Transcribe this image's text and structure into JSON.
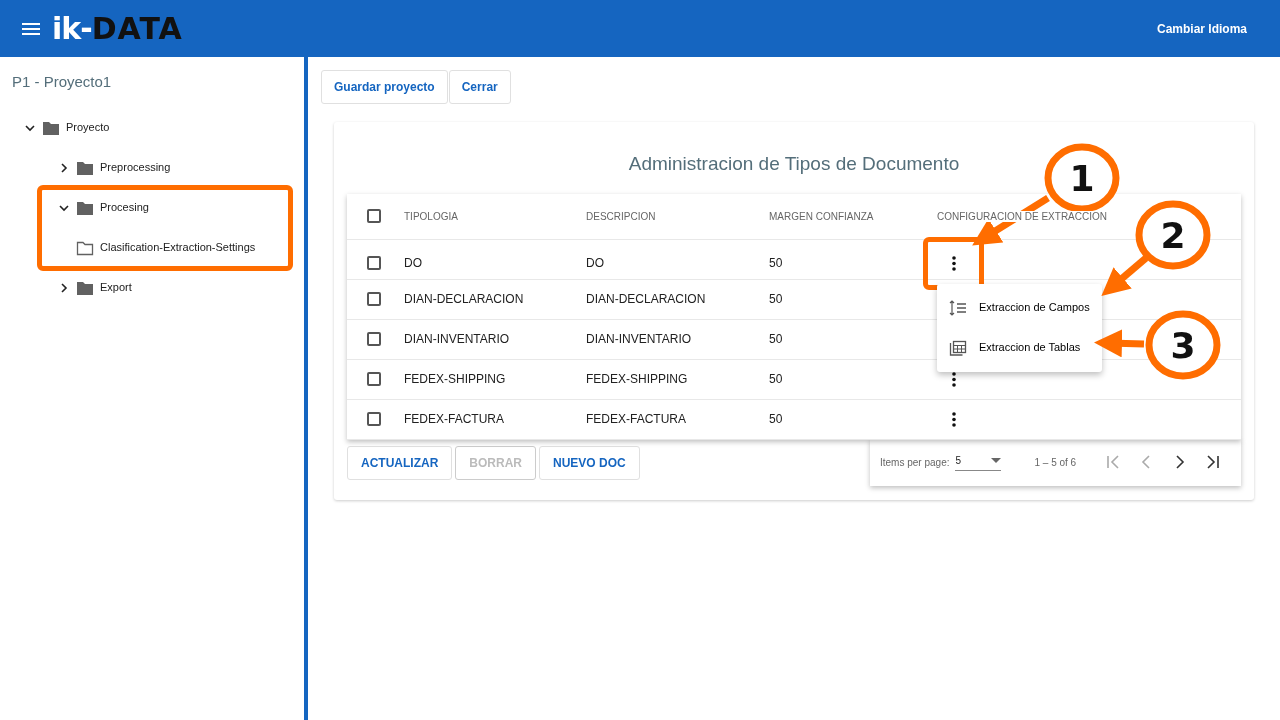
{
  "header": {
    "logo_light": "ik-",
    "logo_dark": "DATA",
    "language_button": "Cambiar Idioma"
  },
  "sidebar": {
    "title": "P1 - Proyecto1",
    "tree": [
      {
        "label": "Proyecto",
        "kind": "folder",
        "expanded": true,
        "highlighted": false,
        "children": [
          {
            "label": "Preprocessing",
            "kind": "folder",
            "expanded": false,
            "highlighted": false
          },
          {
            "label": "Procesing",
            "kind": "folder",
            "expanded": true,
            "highlighted": true,
            "children": [
              {
                "label": "Clasification-Extraction-Settings",
                "kind": "leaf",
                "highlighted": false
              }
            ]
          },
          {
            "label": "Export",
            "kind": "folder",
            "expanded": false,
            "highlighted": false
          }
        ]
      }
    ]
  },
  "toolbar": [
    "Guardar proyecto",
    "Cerrar"
  ],
  "panel": {
    "title": "Administracion de Tipos de Documento",
    "table": {
      "select_all_checked": false,
      "columns": [
        "TIPOLOGIA",
        "DESCRIPCION",
        "MARGEN CONFIANZA",
        "CONFIGURACION DE EXTRACCION"
      ],
      "rows": [
        {
          "checked": false,
          "cells": [
            "DO",
            "DO",
            "50"
          ],
          "actions": true,
          "highlighted": true
        },
        {
          "checked": false,
          "cells": [
            "DIAN-DECLARACION",
            "DIAN-DECLARACION",
            "50"
          ],
          "actions": false
        },
        {
          "checked": false,
          "cells": [
            "DIAN-INVENTARIO",
            "DIAN-INVENTARIO",
            "50"
          ],
          "actions": false
        },
        {
          "checked": false,
          "cells": [
            "FEDEX-SHIPPING",
            "FEDEX-SHIPPING",
            "50"
          ],
          "actions": true,
          "highlighted": false
        },
        {
          "checked": false,
          "cells": [
            "FEDEX-FACTURA",
            "FEDEX-FACTURA",
            "50"
          ],
          "actions": true,
          "highlighted": false
        }
      ]
    },
    "menu": [
      {
        "label": "Extraccion de Campos",
        "kind": "fields"
      },
      {
        "label": "Extraccion de Tablas",
        "kind": "tables"
      }
    ],
    "buttons": [
      {
        "label": "ACTUALIZAR",
        "disabled": false
      },
      {
        "label": "BORRAR",
        "disabled": true
      },
      {
        "label": "NUEVO DOC",
        "disabled": false
      }
    ],
    "paginator": {
      "label": "Items per page:",
      "page_size": "5",
      "range": "1 – 5 of 6",
      "nav": [
        {
          "kind": "first",
          "disabled": true
        },
        {
          "kind": "prev",
          "disabled": true
        },
        {
          "kind": "next",
          "disabled": false
        },
        {
          "kind": "last",
          "disabled": false
        }
      ]
    }
  },
  "annotations": [
    {
      "kind": "callout",
      "label": "1"
    },
    {
      "kind": "callout",
      "label": "2"
    },
    {
      "kind": "callout",
      "label": "3"
    }
  ]
}
